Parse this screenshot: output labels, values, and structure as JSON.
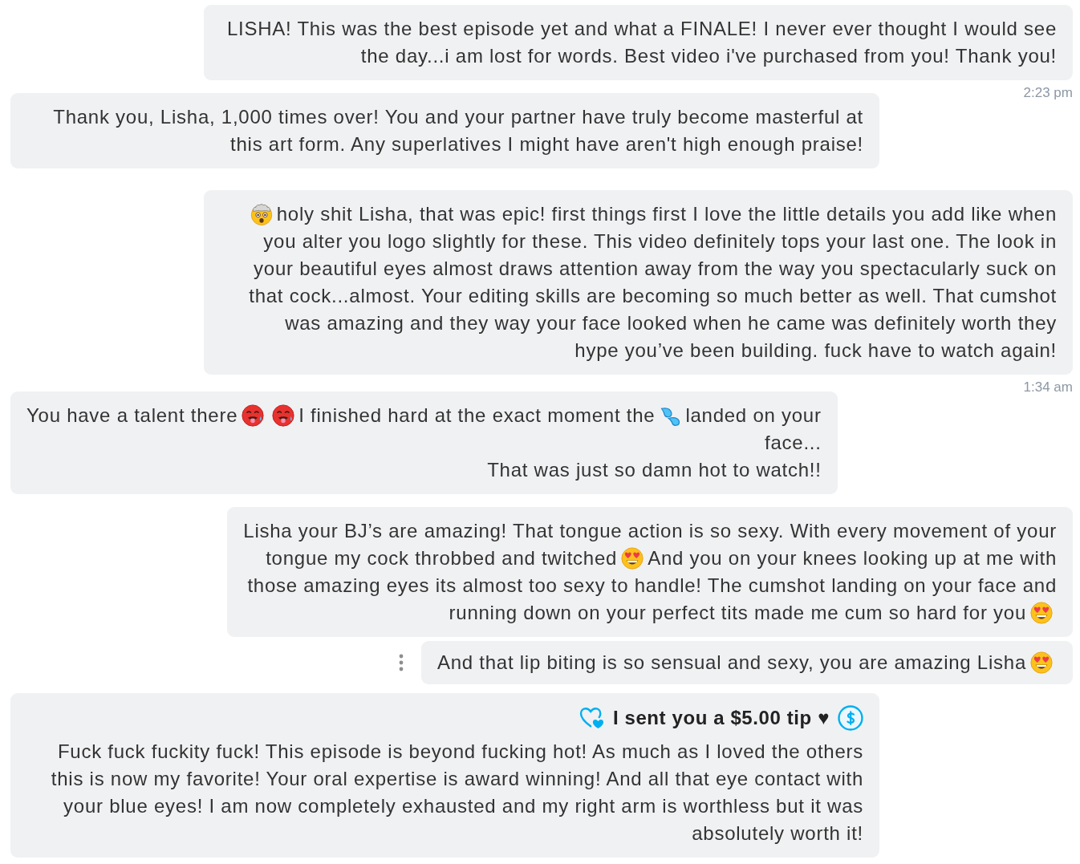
{
  "messages": [
    {
      "kind": "received",
      "options_shown": false,
      "lines": [
        [
          {
            "kind": "text",
            "text": "LISHA! This was the best episode yet and what a FINALE! I never ever thought I would see the day...i am lost for words. Best video i've purchased from you! Thank you!"
          }
        ]
      ],
      "time": "2:23 pm"
    },
    {
      "kind": "sent",
      "options_shown": false,
      "lines": [
        [
          {
            "kind": "text",
            "text": "Thank you, Lisha, 1,000 times over! You and your partner have truly become masterful at this art form. Any superlatives I might have aren't high enough praise!"
          }
        ]
      ]
    },
    {
      "kind": "received",
      "options_shown": false,
      "lines": [
        [
          {
            "kind": "shocked_face"
          },
          {
            "kind": "text",
            "text": "holy shit Lisha, that was epic! first things first I love the little details you add like when"
          }
        ],
        [
          {
            "kind": "text",
            "text": "you alter you logo slightly for these. This video definitely tops your last one. The look in your beautiful eyes almost draws attention away from the way you spectacularly suck on that cock...almost. Your editing skills are becoming so much better as well. That cumshot was amazing and they way your face looked when he came was definitely worth they hype you’ve been building. fuck have to watch again!"
          }
        ]
      ],
      "time": "1:34 am"
    },
    {
      "kind": "sent",
      "options_shown": false,
      "lines": [
        [
          {
            "kind": "text",
            "text": "You have a talent there"
          },
          {
            "kind": "hot_face"
          },
          {
            "kind": "hot_face"
          },
          {
            "kind": "text",
            "text": "I finished hard at the exact moment the"
          },
          {
            "kind": "droplets"
          },
          {
            "kind": "text",
            "text": "landed on your"
          }
        ],
        [
          {
            "kind": "text",
            "text": "face..."
          }
        ],
        [
          {
            "kind": "text",
            "text": "That was just so damn hot to watch!!"
          }
        ]
      ]
    },
    {
      "kind": "received",
      "options_shown": false,
      "lines": [
        [
          {
            "kind": "text",
            "text": "Lisha your BJ’s are amazing! That tongue action is so sexy. With every movement of your"
          }
        ],
        [
          {
            "kind": "text",
            "text": "tongue my cock throbbed and twitched"
          },
          {
            "kind": "heart_eyes"
          },
          {
            "kind": "text",
            "text": "And you on your knees looking up at me with"
          }
        ],
        [
          {
            "kind": "text",
            "text": "those amazing eyes its almost too sexy to handle! The cumshot landing on your face and"
          }
        ],
        [
          {
            "kind": "text",
            "text": "running down on your perfect tits made me cum so hard for you"
          },
          {
            "kind": "heart_eyes"
          }
        ]
      ]
    },
    {
      "kind": "received",
      "options_shown": true,
      "lines": [
        [
          {
            "kind": "text",
            "text": "And that lip biting is so sensual and sexy, you are amazing Lisha"
          },
          {
            "kind": "heart_eyes"
          }
        ]
      ]
    },
    {
      "kind": "sent",
      "options_shown": false,
      "tip": "I sent you a $5.00 tip ♥",
      "lines": [
        [
          {
            "kind": "text",
            "text": "Fuck fuck fuckity fuck! This episode is beyond fucking hot! As much as I loved the others this is now my favorite! Your oral expertise is award winning! And all that eye contact with your blue eyes! I am now completely exhausted and my right arm is worthless but it was absolutely worth it!"
          }
        ]
      ]
    }
  ]
}
